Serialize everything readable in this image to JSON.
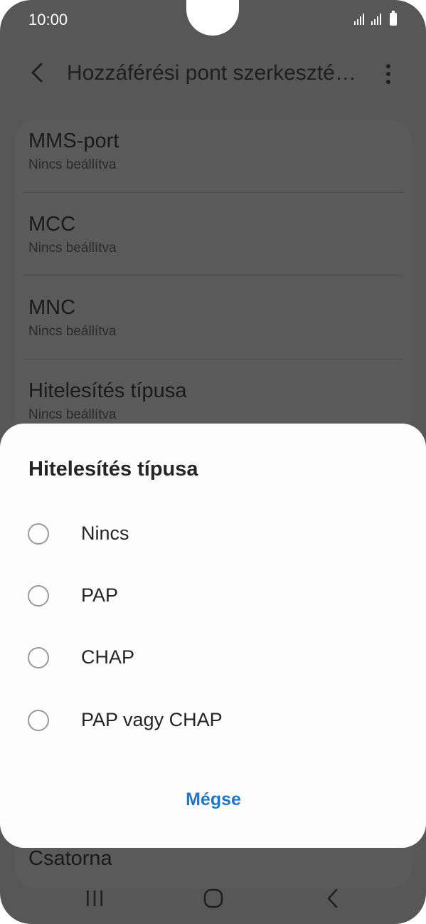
{
  "status_bar": {
    "time": "10:00"
  },
  "header": {
    "title": "Hozzáférési pont szerkeszté…"
  },
  "settings": [
    {
      "title": "MMS-port",
      "value": "Nincs beállítva"
    },
    {
      "title": "MCC",
      "value": "Nincs beállítva"
    },
    {
      "title": "MNC",
      "value": "Nincs beállítva"
    },
    {
      "title": "Hitelesítés típusa",
      "value": "Nincs beállítva"
    }
  ],
  "behind_dialog_item": "Csatorna",
  "dialog": {
    "title": "Hitelesítés típusa",
    "options": [
      "Nincs",
      "PAP",
      "CHAP",
      "PAP vagy CHAP"
    ],
    "cancel_label": "Mégse"
  },
  "colors": {
    "accent": "#1b78cf",
    "scrim": "#575757",
    "dialog_bg": "#fdfdfd"
  }
}
